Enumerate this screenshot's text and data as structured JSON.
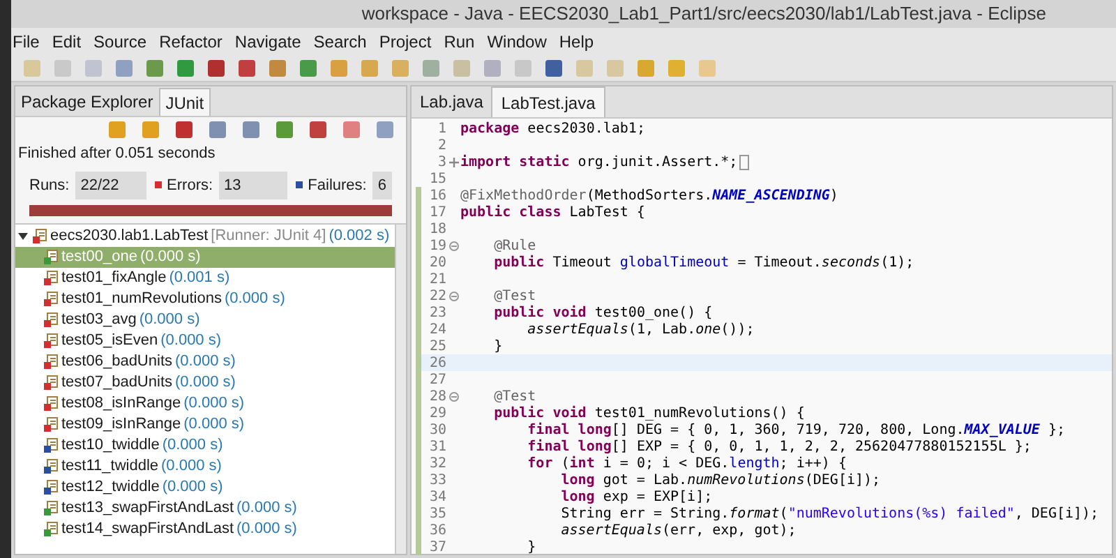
{
  "window": {
    "title": "workspace - Java - EECS2030_Lab1_Part1/src/eecs2030/lab1/LabTest.java - Eclipse"
  },
  "menu": [
    "File",
    "Edit",
    "Source",
    "Refactor",
    "Navigate",
    "Search",
    "Project",
    "Run",
    "Window",
    "Help"
  ],
  "view_tabs": [
    {
      "label": "Package Explorer",
      "selected": false
    },
    {
      "label": "JUnit",
      "selected": true
    }
  ],
  "junit": {
    "status": "Finished after 0.051 seconds",
    "runs_label": "Runs:",
    "runs": "22/22",
    "errors_label": "Errors:",
    "errors": "13",
    "failures_label": "Failures:",
    "failures": "6",
    "failed": true,
    "root": {
      "name": "eecs2030.lab1.LabTest",
      "runner": "[Runner: JUnit 4]",
      "time": "(0.002 s)",
      "expanded": true
    },
    "tests": [
      {
        "name": "test00_one",
        "time": "(0.000 s)",
        "kind": "pass",
        "selected": true
      },
      {
        "name": "test01_fixAngle",
        "time": "(0.001 s)",
        "kind": "error",
        "selected": false
      },
      {
        "name": "test01_numRevolutions",
        "time": "(0.000 s)",
        "kind": "error",
        "selected": false
      },
      {
        "name": "test03_avg",
        "time": "(0.000 s)",
        "kind": "error",
        "selected": false
      },
      {
        "name": "test05_isEven",
        "time": "(0.000 s)",
        "kind": "error",
        "selected": false
      },
      {
        "name": "test06_badUnits",
        "time": "(0.000 s)",
        "kind": "error",
        "selected": false
      },
      {
        "name": "test07_badUnits",
        "time": "(0.000 s)",
        "kind": "error",
        "selected": false
      },
      {
        "name": "test08_isInRange",
        "time": "(0.000 s)",
        "kind": "error",
        "selected": false
      },
      {
        "name": "test09_isInRange",
        "time": "(0.000 s)",
        "kind": "error",
        "selected": false
      },
      {
        "name": "test10_twiddle",
        "time": "(0.000 s)",
        "kind": "failure",
        "selected": false
      },
      {
        "name": "test11_twiddle",
        "time": "(0.000 s)",
        "kind": "failure",
        "selected": false
      },
      {
        "name": "test12_twiddle",
        "time": "(0.000 s)",
        "kind": "failure",
        "selected": false
      },
      {
        "name": "test13_swapFirstAndLast",
        "time": "(0.000 s)",
        "kind": "pass",
        "selected": false
      },
      {
        "name": "test14_swapFirstAndLast",
        "time": "(0.000 s)",
        "kind": "pass",
        "selected": false
      }
    ]
  },
  "editor_tabs": [
    {
      "label": "Lab.java",
      "selected": false
    },
    {
      "label": "LabTest.java",
      "selected": true
    }
  ],
  "code": [
    {
      "n": "1",
      "segs": [
        {
          "t": "package",
          "kind": "kw"
        },
        {
          "t": " eecs2030.lab1;",
          "kind": "plain"
        }
      ]
    },
    {
      "n": "2"
    },
    {
      "n": "3",
      "folded": true,
      "segs": [
        {
          "t": "import",
          "kind": "kw"
        },
        {
          "t": " static",
          "kind": "kw"
        },
        {
          "t": " org.junit.Assert.*;",
          "kind": "plain"
        }
      ]
    },
    {
      "n": "15"
    },
    {
      "n": "16",
      "segs": [
        {
          "t": "@FixMethodOrder",
          "kind": "ann"
        },
        {
          "t": "(MethodSorters.",
          "kind": "plain"
        },
        {
          "t": "NAME_ASCENDING",
          "kind": "const"
        },
        {
          "t": ")",
          "kind": "plain"
        }
      ]
    },
    {
      "n": "17",
      "segs": [
        {
          "t": "public",
          "kind": "kw"
        },
        {
          "t": " class",
          "kind": "kw"
        },
        {
          "t": " LabTest {",
          "kind": "plain"
        }
      ]
    },
    {
      "n": "18"
    },
    {
      "n": "19",
      "folded": false,
      "segs": [
        {
          "t": "    @Rule",
          "kind": "ann"
        }
      ]
    },
    {
      "n": "20",
      "segs": [
        {
          "t": "    public",
          "kind": "kw"
        },
        {
          "t": " Timeout ",
          "kind": "plain"
        },
        {
          "t": "globalTimeout",
          "kind": "field"
        },
        {
          "t": " = Timeout.",
          "kind": "plain"
        },
        {
          "t": "seconds",
          "kind": "italic"
        },
        {
          "t": "(1);",
          "kind": "plain"
        }
      ]
    },
    {
      "n": "21"
    },
    {
      "n": "22",
      "folded": false,
      "segs": [
        {
          "t": "    @Test",
          "kind": "ann"
        }
      ]
    },
    {
      "n": "23",
      "segs": [
        {
          "t": "    public",
          "kind": "kw"
        },
        {
          "t": " void",
          "kind": "kw"
        },
        {
          "t": " test00_one() {",
          "kind": "plain"
        }
      ]
    },
    {
      "n": "24",
      "segs": [
        {
          "t": "        assertEquals",
          "kind": "italic"
        },
        {
          "t": "(1, Lab.",
          "kind": "plain"
        },
        {
          "t": "one",
          "kind": "italic"
        },
        {
          "t": "());",
          "kind": "plain"
        }
      ]
    },
    {
      "n": "25",
      "segs": [
        {
          "t": "    }",
          "kind": "plain"
        }
      ]
    },
    {
      "n": "26",
      "current": true
    },
    {
      "n": "27"
    },
    {
      "n": "28",
      "folded": false,
      "segs": [
        {
          "t": "    @Test",
          "kind": "ann"
        }
      ]
    },
    {
      "n": "29",
      "segs": [
        {
          "t": "    public",
          "kind": "kw"
        },
        {
          "t": " void",
          "kind": "kw"
        },
        {
          "t": " test01_numRevolutions() {",
          "kind": "plain"
        }
      ]
    },
    {
      "n": "30",
      "segs": [
        {
          "t": "        final",
          "kind": "kw"
        },
        {
          "t": " long",
          "kind": "kw"
        },
        {
          "t": "[] DEG = { 0, 1, 360, 719, 720, 800, Long.",
          "kind": "plain"
        },
        {
          "t": "MAX_VALUE",
          "kind": "const"
        },
        {
          "t": " };",
          "kind": "plain"
        }
      ]
    },
    {
      "n": "31",
      "segs": [
        {
          "t": "        final",
          "kind": "kw"
        },
        {
          "t": " long",
          "kind": "kw"
        },
        {
          "t": "[] EXP = { 0, 0, 1, 1, 2, 2, 25620477880152155L };",
          "kind": "plain"
        }
      ]
    },
    {
      "n": "32",
      "segs": [
        {
          "t": "        for",
          "kind": "kw"
        },
        {
          "t": " (",
          "kind": "plain"
        },
        {
          "t": "int",
          "kind": "kw"
        },
        {
          "t": " i = 0; i < DEG.",
          "kind": "plain"
        },
        {
          "t": "length",
          "kind": "field"
        },
        {
          "t": "; i++) {",
          "kind": "plain"
        }
      ]
    },
    {
      "n": "33",
      "segs": [
        {
          "t": "            long",
          "kind": "kw"
        },
        {
          "t": " got = Lab.",
          "kind": "plain"
        },
        {
          "t": "numRevolutions",
          "kind": "italic"
        },
        {
          "t": "(DEG[i]);",
          "kind": "plain"
        }
      ]
    },
    {
      "n": "34",
      "segs": [
        {
          "t": "            long",
          "kind": "kw"
        },
        {
          "t": " exp = EXP[i];",
          "kind": "plain"
        }
      ]
    },
    {
      "n": "35",
      "segs": [
        {
          "t": "            String err = String.",
          "kind": "plain"
        },
        {
          "t": "format",
          "kind": "italic"
        },
        {
          "t": "(",
          "kind": "plain"
        },
        {
          "t": "\"numRevolutions(%s) failed\"",
          "kind": "str"
        },
        {
          "t": ", DEG[i]);",
          "kind": "plain"
        }
      ]
    },
    {
      "n": "36",
      "segs": [
        {
          "t": "            assertEquals",
          "kind": "italic"
        },
        {
          "t": "(err, exp, got);",
          "kind": "plain"
        }
      ]
    },
    {
      "n": "37",
      "segs": [
        {
          "t": "        }",
          "kind": "plain"
        }
      ]
    }
  ]
}
